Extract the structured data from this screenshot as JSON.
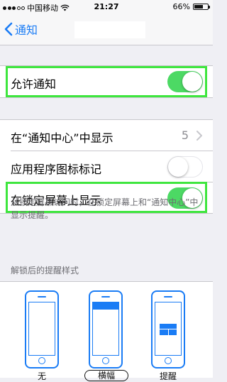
{
  "status_bar": {
    "carrier": "中国移动",
    "time": "21:27",
    "battery": "66%",
    "battery_level": 0.66
  },
  "nav": {
    "back_label": "通知"
  },
  "settings": {
    "allow_notifications": {
      "label": "允许通知",
      "on": true
    },
    "show_in_center": {
      "label": "在“通知中心”中显示",
      "value": "5"
    },
    "badge_app_icon": {
      "label": "应用程序图标标记",
      "on": false
    },
    "show_on_lock_screen": {
      "label": "在锁定屏幕上显示",
      "on": true
    },
    "footnote": "从锁定屏幕访问时，在锁定屏幕上和“通知中心”中显示提醒。"
  },
  "alert_style": {
    "header": "解锁后的提醒样式",
    "options": [
      {
        "label": "无",
        "selected": false
      },
      {
        "label": "横幅",
        "selected": true
      },
      {
        "label": "提醒",
        "selected": false
      }
    ]
  },
  "colors": {
    "accent": "#1a7cf5",
    "toggle_on": "#4cd964",
    "highlight": "#3ee63e"
  }
}
